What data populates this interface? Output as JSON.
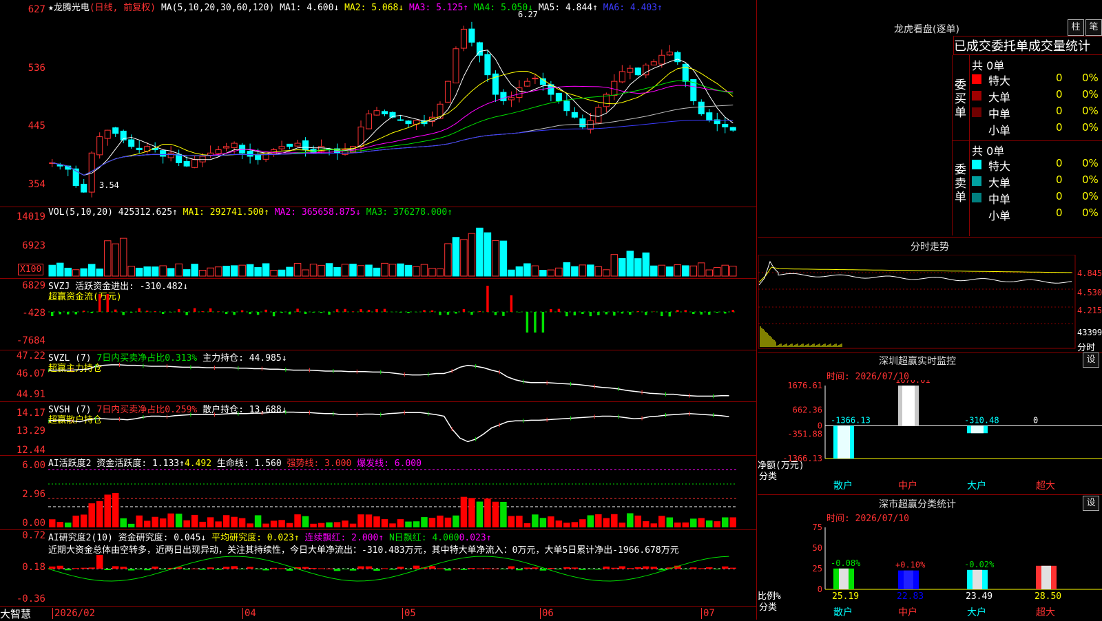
{
  "main": {
    "stock_name": "★龙腾光电",
    "period": "(日线, 前复权)",
    "ma_prefix": "MA(5,10,20,30,60,120)",
    "ma1": "MA1: 4.600↓",
    "ma2": "MA2: 5.068↓",
    "ma3": "MA3: 5.125↑",
    "ma4": "MA4: 5.050↓",
    "ma5": "MA5: 4.844↑",
    "ma6": "MA6: 4.403↑",
    "high_label": "6.27",
    "low_label": "3.54",
    "y_ticks": [
      "627",
      "536",
      "445",
      "354"
    ]
  },
  "vol": {
    "header": "VOL(5,10,20)",
    "value": "425312.625↑",
    "ma1": "MA1: 292741.500↑",
    "ma2": "MA2: 365658.875↓",
    "ma3": "MA3: 376278.000↑",
    "y_ticks": [
      "14019",
      "6923"
    ],
    "unit": "X100"
  },
  "svzj": {
    "header": "SVZJ  活跃资金进出: -310.482↓",
    "sub": "超赢资金流(万元)",
    "y_ticks": [
      "6829",
      "-428",
      "-7684"
    ]
  },
  "svzl": {
    "header_a": "SVZL (7)",
    "header_b": "7日内买卖净占比0.313%",
    "header_c": "主力持仓: 44.985↓",
    "sub": "超赢主力持仓",
    "y_ticks": [
      "47.22",
      "46.07",
      "44.91"
    ]
  },
  "svsh": {
    "header_a": "SVSH (7)",
    "header_b": "7日内买卖净占比0.259%",
    "header_c": "散户持仓: 13.688↓",
    "sub": "超赢散户持仓",
    "y_ticks": [
      "14.17",
      "13.29",
      "12.44"
    ]
  },
  "ai1": {
    "a": "AI活跃度2",
    "b": "资金活跃度: 1.133↑",
    "c": "4.492",
    "d": "生命线: 1.560",
    "e": "强势线: 3.000",
    "f": "爆发线: 6.000",
    "y_ticks": [
      "6.00",
      "2.96",
      "0.00"
    ]
  },
  "ai2": {
    "a": "AI研究度2(10)",
    "b": "资金研究度: 0.045↓",
    "c": "平均研究度: 0.023↑",
    "d": "连续飘红: 2.000↑",
    "e": "N日飘红: 4.000",
    "f": "0.023↑",
    "comment": "近期大资金总体由空转多，近两日出现异动，关注其持续性，今日大单净流出：-310.483万元，其中特大单净流入：0万元，大单5日累计净出-1966.678万元",
    "y_ticks": [
      "0.72",
      "0.18",
      "-0.36"
    ]
  },
  "xaxis": {
    "brand": "大智慧",
    "labels": [
      "2026/02",
      "04",
      "05",
      "06",
      "07"
    ]
  },
  "lhb": {
    "title": "龙虎看盘(逐单)",
    "btn1": "柱",
    "btn2": "笔",
    "tabs": "已成交委托单成交量统计",
    "buy_label": "委买单",
    "sell_label": "委卖单",
    "buy_total": "共 0单",
    "sell_total": "共 0单",
    "buy_rows": [
      {
        "name": "特大",
        "count": "0",
        "pct": "0%",
        "color": "#ff0000"
      },
      {
        "name": "大单",
        "count": "0",
        "pct": "0%",
        "color": "#a00000"
      },
      {
        "name": "中单",
        "count": "0",
        "pct": "0%",
        "color": "#700000"
      },
      {
        "name": "小单",
        "count": "0",
        "pct": "0%",
        "color": ""
      }
    ],
    "sell_rows": [
      {
        "name": "特大",
        "count": "0",
        "pct": "0%",
        "color": "#00ffff"
      },
      {
        "name": "大单",
        "count": "0",
        "pct": "0%",
        "color": "#00a0a0"
      },
      {
        "name": "中单",
        "count": "0",
        "pct": "0%",
        "color": "#008080"
      },
      {
        "name": "小单",
        "count": "0",
        "pct": "0%",
        "color": ""
      }
    ]
  },
  "fenshi": {
    "title": "分时走势",
    "y_ticks": [
      "4.845",
      "4.530",
      "4.215",
      "43399"
    ],
    "unit": "分时"
  },
  "sz_monitor": {
    "title": "深圳超赢实时监控",
    "btn": "设",
    "time": "时间: 2026/07/10",
    "y_ticks": [
      "1676.61",
      "662.36",
      "0",
      "-351.88",
      "-1366.13"
    ],
    "ylabel": "净额(万元)",
    "xlabel": "分类",
    "bars": [
      {
        "cat": "散户",
        "value": "-1366.13"
      },
      {
        "cat": "中户",
        "value": "1676.61"
      },
      {
        "cat": "大户",
        "value": "-310.48"
      },
      {
        "cat": "超大",
        "value": "0"
      }
    ]
  },
  "sz_class": {
    "title": "深市超赢分类统计",
    "btn": "设",
    "time": "时间: 2026/07/10",
    "y_ticks": [
      "75",
      "50",
      "25",
      "0"
    ],
    "ylabel": "比例%",
    "xlabel": "分类",
    "bars": [
      {
        "cat": "散户",
        "pct": "25.19",
        "chg": "-0.08%"
      },
      {
        "cat": "中户",
        "pct": "22.83",
        "chg": "+0.10%"
      },
      {
        "cat": "大户",
        "pct": "23.49",
        "chg": "-0.02%"
      },
      {
        "cat": "超大",
        "pct": "28.50",
        "chg": ""
      }
    ]
  },
  "chart_data": [
    {
      "type": "bar",
      "title": "深圳超赢实时监控",
      "ylabel": "净额(万元)",
      "xlabel": "分类",
      "categories": [
        "散户",
        "中户",
        "大户",
        "超大"
      ],
      "values": [
        -1366.13,
        1676.61,
        -310.48,
        0
      ],
      "ylim": [
        -1366.13,
        1676.61
      ]
    },
    {
      "type": "bar",
      "title": "深市超赢分类统计",
      "ylabel": "比例%",
      "xlabel": "分类",
      "categories": [
        "散户",
        "中户",
        "大户",
        "超大"
      ],
      "values": [
        25.19,
        22.83,
        23.49,
        28.5
      ],
      "ylim": [
        0,
        75
      ]
    }
  ]
}
